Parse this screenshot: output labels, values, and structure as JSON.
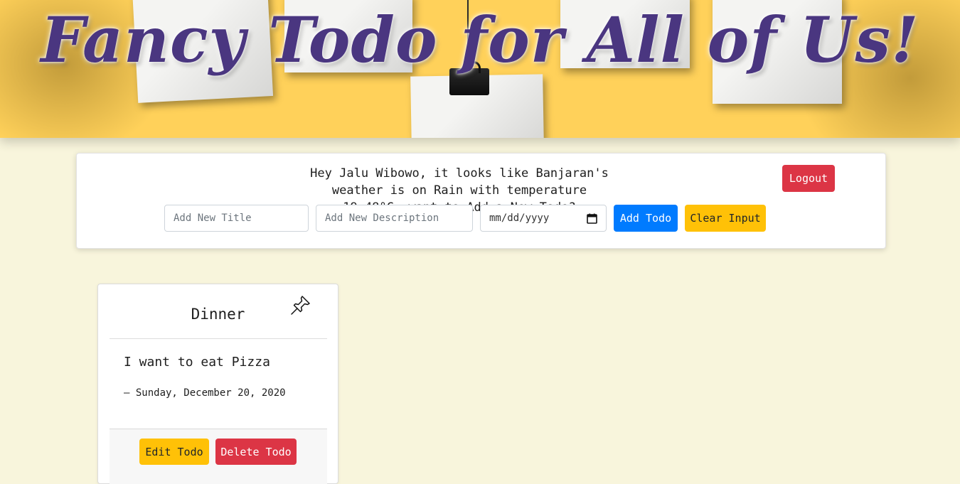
{
  "banner": {
    "title": "Fancy Todo for All of Us!"
  },
  "header": {
    "greeting": "Hey Jalu Wibowo, it looks like Banjaran's weather is on Rain with temperature 19.48°C, want to Add a New Todo?",
    "logout_label": "Logout"
  },
  "form": {
    "title_placeholder": "Add New Title",
    "description_placeholder": "Add New Description",
    "date_placeholder": "mm/dd/yyyy",
    "add_label": "Add Todo",
    "clear_label": "Clear Input"
  },
  "todos": [
    {
      "title": "Dinner",
      "description": "I want to eat Pizza",
      "date": "— Sunday, December 20, 2020",
      "pin_icon": "pushpin-icon",
      "edit_label": "Edit Todo",
      "delete_label": "Delete Todo"
    }
  ],
  "colors": {
    "background": "#f8f5dc",
    "banner": "#ffd15a",
    "title": "#4a3680",
    "primary": "#007bff",
    "warning": "#ffc107",
    "danger": "#dc3545"
  }
}
